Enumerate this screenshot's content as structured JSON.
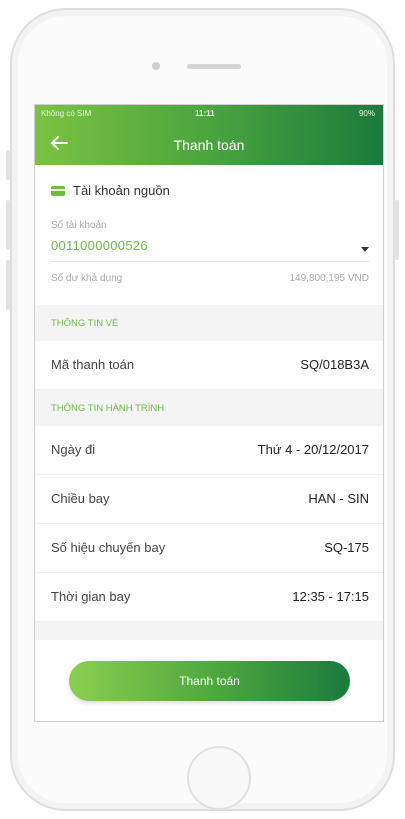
{
  "status_bar": {
    "carrier": "Không có SIM",
    "time": "11:11",
    "battery": "90%"
  },
  "header": {
    "title": "Thanh toán"
  },
  "source_account": {
    "title": "Tài khoản nguồn",
    "account_label": "Số tài khoản",
    "account_number": "0011000000526",
    "balance_label": "Số dư khả dụng",
    "balance_value": "149,800,195 VND"
  },
  "ticket_info": {
    "section_title": "THÔNG TIN VÉ",
    "payment_code_label": "Mã thanh toán",
    "payment_code_value": "SQ/018B3A"
  },
  "itinerary": {
    "section_title": "THÔNG TIN HÀNH TRÌNH",
    "rows": [
      {
        "label": "Ngày đi",
        "value": "Thứ 4 - 20/12/2017"
      },
      {
        "label": "Chiều bay",
        "value": "HAN - SIN"
      },
      {
        "label": "Số hiệu chuyến bay",
        "value": "SQ-175"
      },
      {
        "label": "Thời gian bay",
        "value": "12:35 - 17:15"
      }
    ]
  },
  "pay_button": {
    "label": "Thanh toán"
  },
  "colors": {
    "brand_green": "#6dbb45",
    "dark_green": "#1b7a3d"
  }
}
